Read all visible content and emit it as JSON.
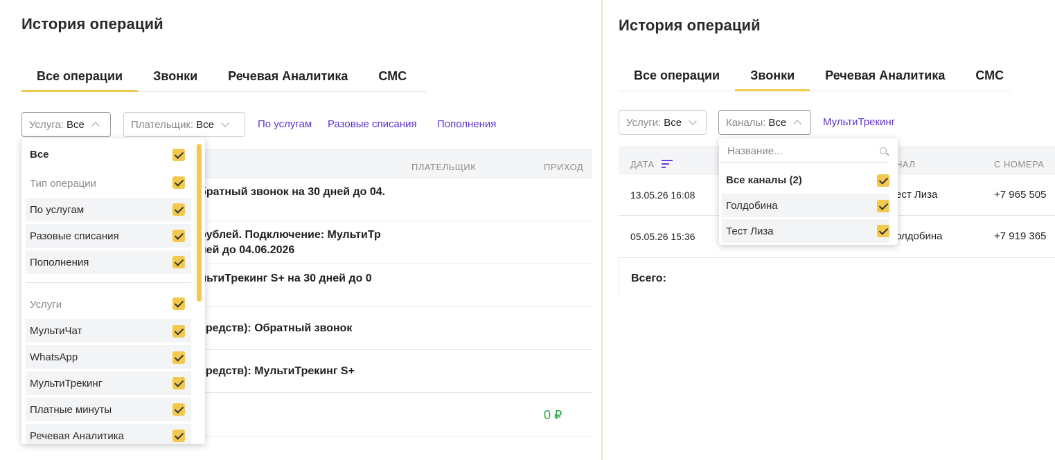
{
  "left": {
    "title": "История операций",
    "tabs": [
      "Все операции",
      "Звонки",
      "Речевая Аналитика",
      "СМС"
    ],
    "filters": {
      "service": {
        "label": "Услуга:",
        "value": "Все"
      },
      "payer": {
        "label": "Плательщик:",
        "value": "Все"
      }
    },
    "links": [
      "По услугам",
      "Разовые списания",
      "Пополнения"
    ],
    "headers": {
      "payer": "ПЛАТЕЛЬЩИК",
      "income": "ПРИХОД"
    },
    "rows": [
      {
        "line1": "братный звонок на 30 дней до 04.",
        "line2": ""
      },
      {
        "line1": "рублей. Подключение: МультиТр",
        "line2": "ней до 04.06.2026"
      },
      {
        "line1": "льтиТрекинг S+ на 30 дней до 0",
        "line2": ""
      },
      {
        "line1": "средств): Обратный звонок",
        "line2": ""
      },
      {
        "line1": "средств): МультиТрекинг S+",
        "line2": ""
      }
    ],
    "total_income": "0 ₽",
    "dropdown": {
      "all": "Все",
      "group_op": "Тип операции",
      "op_items": [
        "По услугам",
        "Разовые списания",
        "Пополнения"
      ],
      "group_services": "Услуги",
      "service_items": [
        "МультиЧат",
        "WhatsApp",
        "МультиТрекинг",
        "Платные минуты",
        "Речевая Аналитика"
      ]
    }
  },
  "right": {
    "title": "История операций",
    "tabs": [
      "Все операции",
      "Звонки",
      "Речевая Аналитика",
      "СМС"
    ],
    "filters": {
      "services": {
        "label": "Услуги:",
        "value": "Все"
      },
      "channels": {
        "label": "Каналы:",
        "value": "Все"
      }
    },
    "link": "МультиТрекинг",
    "headers": {
      "date": "ДАТА",
      "channel": "НАЛ",
      "from": "С НОМЕРА"
    },
    "rows": [
      {
        "date": "13.05.26 16:08",
        "channel": "ест Лиза",
        "from": "+7 965 505"
      },
      {
        "date": "05.05.26 15:36",
        "channel": "олдобина",
        "from": "+7 919 365"
      }
    ],
    "total_label": "Всего:",
    "dropdown": {
      "search_placeholder": "Название...",
      "all": "Все каналы (2)",
      "items": [
        "Голдобина",
        "Тест Лиза"
      ]
    }
  },
  "colors": {
    "accent_yellow": "#f2c94c",
    "link_purple": "#5d30d6",
    "income_green": "#29a745"
  }
}
